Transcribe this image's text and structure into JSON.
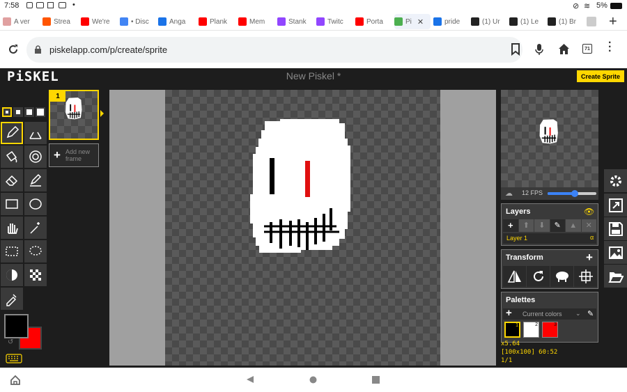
{
  "status": {
    "time": "7:58",
    "battery": "5%"
  },
  "tabs": [
    {
      "label": "A ver",
      "color": "#e0a0a0"
    },
    {
      "label": "Strea",
      "color": "#ff5500"
    },
    {
      "label": "We're",
      "color": "#ff0000"
    },
    {
      "label": "• Disc",
      "color": "#4285f4"
    },
    {
      "label": "Anga",
      "color": "#1a73e8"
    },
    {
      "label": "Plank",
      "color": "#ff0000"
    },
    {
      "label": "Mem",
      "color": "#ff0000"
    },
    {
      "label": "Stank",
      "color": "#9146ff"
    },
    {
      "label": "Twitc",
      "color": "#9146ff"
    },
    {
      "label": "Porta",
      "color": "#ff0000"
    },
    {
      "label": "Pi",
      "color": "#4caf50"
    },
    {
      "label": "pride",
      "color": "#1a73e8"
    },
    {
      "label": "(1) Ur",
      "color": "#222222"
    },
    {
      "label": "(1) Le",
      "color": "#222222"
    },
    {
      "label": "(1) Br",
      "color": "#222222"
    }
  ],
  "url": "piskelapp.com/p/create/sprite",
  "tab_count": "71",
  "app": {
    "logo": "PiSKEL",
    "title": "New Piskel *",
    "create_sprite": "Create Sprite"
  },
  "frames": {
    "frame_number": "1",
    "add_new_frame": "Add new frame"
  },
  "preview": {
    "fps": "12 FPS",
    "fps_level": 0.55
  },
  "layers": {
    "title": "Layers",
    "layer_name": "Layer 1",
    "alpha": "α"
  },
  "transform": {
    "title": "Transform"
  },
  "palettes": {
    "title": "Palettes",
    "current": "Current colors",
    "swatches": [
      {
        "num": "1",
        "color": "#000000"
      },
      {
        "num": "2",
        "color": "#ffffff"
      },
      {
        "num": "3",
        "color": "#ff0000"
      }
    ]
  },
  "cursor_info": {
    "zoom": "x5.64",
    "size_pos": "[100x100] 60:52",
    "frame": "1/1"
  },
  "colors": {
    "primary": "#000000",
    "secondary": "#ff0000",
    "accent": "#ffd700"
  }
}
